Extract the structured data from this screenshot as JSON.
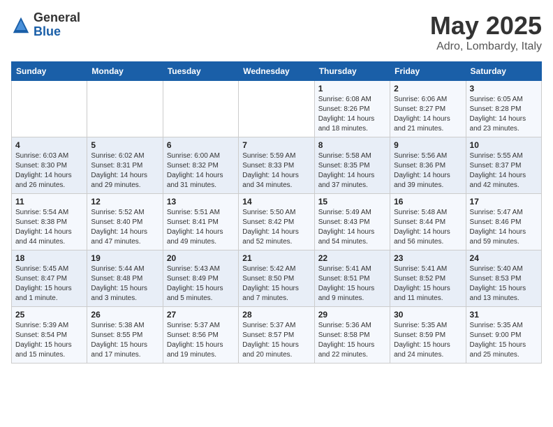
{
  "logo": {
    "general": "General",
    "blue": "Blue"
  },
  "title": "May 2025",
  "location": "Adro, Lombardy, Italy",
  "headers": [
    "Sunday",
    "Monday",
    "Tuesday",
    "Wednesday",
    "Thursday",
    "Friday",
    "Saturday"
  ],
  "weeks": [
    [
      {
        "day": "",
        "info": ""
      },
      {
        "day": "",
        "info": ""
      },
      {
        "day": "",
        "info": ""
      },
      {
        "day": "",
        "info": ""
      },
      {
        "day": "1",
        "info": "Sunrise: 6:08 AM\nSunset: 8:26 PM\nDaylight: 14 hours\nand 18 minutes."
      },
      {
        "day": "2",
        "info": "Sunrise: 6:06 AM\nSunset: 8:27 PM\nDaylight: 14 hours\nand 21 minutes."
      },
      {
        "day": "3",
        "info": "Sunrise: 6:05 AM\nSunset: 8:28 PM\nDaylight: 14 hours\nand 23 minutes."
      }
    ],
    [
      {
        "day": "4",
        "info": "Sunrise: 6:03 AM\nSunset: 8:30 PM\nDaylight: 14 hours\nand 26 minutes."
      },
      {
        "day": "5",
        "info": "Sunrise: 6:02 AM\nSunset: 8:31 PM\nDaylight: 14 hours\nand 29 minutes."
      },
      {
        "day": "6",
        "info": "Sunrise: 6:00 AM\nSunset: 8:32 PM\nDaylight: 14 hours\nand 31 minutes."
      },
      {
        "day": "7",
        "info": "Sunrise: 5:59 AM\nSunset: 8:33 PM\nDaylight: 14 hours\nand 34 minutes."
      },
      {
        "day": "8",
        "info": "Sunrise: 5:58 AM\nSunset: 8:35 PM\nDaylight: 14 hours\nand 37 minutes."
      },
      {
        "day": "9",
        "info": "Sunrise: 5:56 AM\nSunset: 8:36 PM\nDaylight: 14 hours\nand 39 minutes."
      },
      {
        "day": "10",
        "info": "Sunrise: 5:55 AM\nSunset: 8:37 PM\nDaylight: 14 hours\nand 42 minutes."
      }
    ],
    [
      {
        "day": "11",
        "info": "Sunrise: 5:54 AM\nSunset: 8:38 PM\nDaylight: 14 hours\nand 44 minutes."
      },
      {
        "day": "12",
        "info": "Sunrise: 5:52 AM\nSunset: 8:40 PM\nDaylight: 14 hours\nand 47 minutes."
      },
      {
        "day": "13",
        "info": "Sunrise: 5:51 AM\nSunset: 8:41 PM\nDaylight: 14 hours\nand 49 minutes."
      },
      {
        "day": "14",
        "info": "Sunrise: 5:50 AM\nSunset: 8:42 PM\nDaylight: 14 hours\nand 52 minutes."
      },
      {
        "day": "15",
        "info": "Sunrise: 5:49 AM\nSunset: 8:43 PM\nDaylight: 14 hours\nand 54 minutes."
      },
      {
        "day": "16",
        "info": "Sunrise: 5:48 AM\nSunset: 8:44 PM\nDaylight: 14 hours\nand 56 minutes."
      },
      {
        "day": "17",
        "info": "Sunrise: 5:47 AM\nSunset: 8:46 PM\nDaylight: 14 hours\nand 59 minutes."
      }
    ],
    [
      {
        "day": "18",
        "info": "Sunrise: 5:45 AM\nSunset: 8:47 PM\nDaylight: 15 hours\nand 1 minute."
      },
      {
        "day": "19",
        "info": "Sunrise: 5:44 AM\nSunset: 8:48 PM\nDaylight: 15 hours\nand 3 minutes."
      },
      {
        "day": "20",
        "info": "Sunrise: 5:43 AM\nSunset: 8:49 PM\nDaylight: 15 hours\nand 5 minutes."
      },
      {
        "day": "21",
        "info": "Sunrise: 5:42 AM\nSunset: 8:50 PM\nDaylight: 15 hours\nand 7 minutes."
      },
      {
        "day": "22",
        "info": "Sunrise: 5:41 AM\nSunset: 8:51 PM\nDaylight: 15 hours\nand 9 minutes."
      },
      {
        "day": "23",
        "info": "Sunrise: 5:41 AM\nSunset: 8:52 PM\nDaylight: 15 hours\nand 11 minutes."
      },
      {
        "day": "24",
        "info": "Sunrise: 5:40 AM\nSunset: 8:53 PM\nDaylight: 15 hours\nand 13 minutes."
      }
    ],
    [
      {
        "day": "25",
        "info": "Sunrise: 5:39 AM\nSunset: 8:54 PM\nDaylight: 15 hours\nand 15 minutes."
      },
      {
        "day": "26",
        "info": "Sunrise: 5:38 AM\nSunset: 8:55 PM\nDaylight: 15 hours\nand 17 minutes."
      },
      {
        "day": "27",
        "info": "Sunrise: 5:37 AM\nSunset: 8:56 PM\nDaylight: 15 hours\nand 19 minutes."
      },
      {
        "day": "28",
        "info": "Sunrise: 5:37 AM\nSunset: 8:57 PM\nDaylight: 15 hours\nand 20 minutes."
      },
      {
        "day": "29",
        "info": "Sunrise: 5:36 AM\nSunset: 8:58 PM\nDaylight: 15 hours\nand 22 minutes."
      },
      {
        "day": "30",
        "info": "Sunrise: 5:35 AM\nSunset: 8:59 PM\nDaylight: 15 hours\nand 24 minutes."
      },
      {
        "day": "31",
        "info": "Sunrise: 5:35 AM\nSunset: 9:00 PM\nDaylight: 15 hours\nand 25 minutes."
      }
    ]
  ]
}
